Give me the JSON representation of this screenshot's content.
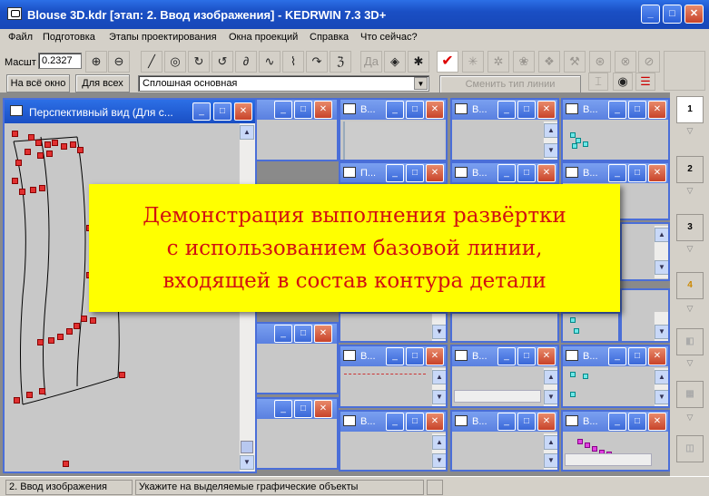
{
  "app": {
    "title": "Blouse 3D.kdr [этап: 2. Ввод изображения] - KEDRWIN 7.3 3D+"
  },
  "titlebar_buttons": {
    "min": "_",
    "max": "□",
    "close": "✕"
  },
  "menu": [
    "Файл",
    "Подготовка",
    "Этапы проектирования",
    "Окна проекций",
    "Справка",
    "Что сейчас?"
  ],
  "toolbar": {
    "scale_label": "Масшт",
    "scale_value": "0.2327",
    "fit_window": "На всё окно",
    "fit_all": "Для всех",
    "line_type": "Сплошная основная",
    "change_line_type": "Сменить тип линии",
    "da_label": "Дa"
  },
  "main_window": {
    "title": "Перспективный вид (Для с..."
  },
  "sub_windows": [
    {
      "title": "В..."
    },
    {
      "title": "П..."
    }
  ],
  "stage_panel": [
    "1",
    "2",
    "3",
    "4"
  ],
  "banner": {
    "line1": "Демонстрация выполнения развёртки",
    "line2": "с использованием базовой линии,",
    "line3": "входящей в состав контура детали"
  },
  "status": {
    "stage": "2. Ввод изображения",
    "hint": "Укажите на выделяемые графические объекты"
  },
  "colors": {
    "title_bar": "#1a4fc4",
    "banner_bg": "#ffff00",
    "banner_text": "#d21010",
    "points": "#e03030",
    "cyan_points": "#6ee8e8"
  }
}
